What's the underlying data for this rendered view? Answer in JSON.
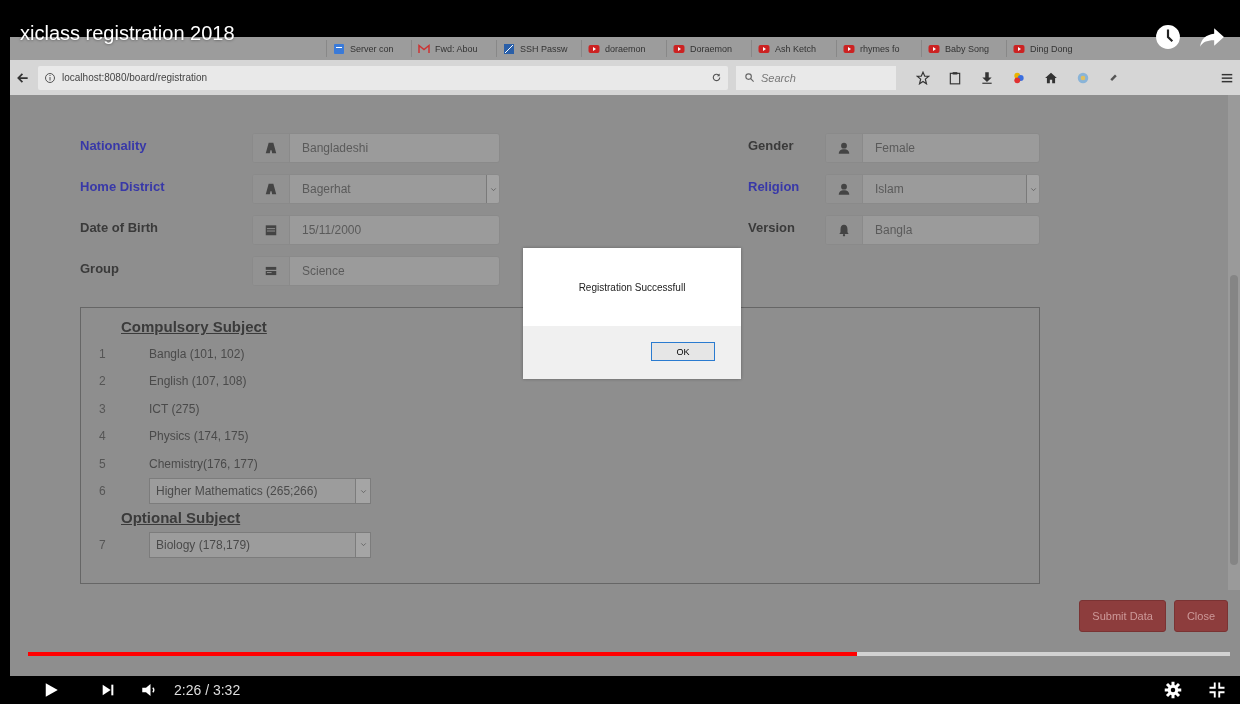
{
  "video": {
    "title": "xiclass registration 2018"
  },
  "browser": {
    "tabs": [
      {
        "label": "Server con",
        "kind": "chat"
      },
      {
        "label": "Fwd: Abou",
        "kind": "mail"
      },
      {
        "label": "SSH Passw",
        "kind": "doc"
      },
      {
        "label": "doraemon",
        "kind": "video"
      },
      {
        "label": "Doraemon",
        "kind": "video"
      },
      {
        "label": "Ash Ketch",
        "kind": "video"
      },
      {
        "label": "rhymes fo",
        "kind": "video"
      },
      {
        "label": "Baby Song",
        "kind": "video"
      },
      {
        "label": "Ding Dong",
        "kind": "video"
      }
    ],
    "url": "localhost:8080/board/registration",
    "search": {
      "placeholder": "Search"
    }
  },
  "form": {
    "left_fields": [
      {
        "label": "Nationality",
        "value": "Bangladeshi",
        "required": true,
        "kind": "text"
      },
      {
        "label": "Home District",
        "value": "Bagerhat",
        "required": true,
        "kind": "select"
      },
      {
        "label": "Date of Birth",
        "value": "15/11/2000",
        "required": false,
        "kind": "text"
      },
      {
        "label": "Group",
        "value": "Science",
        "required": false,
        "kind": "text"
      }
    ],
    "right_fields": [
      {
        "label": "Gender",
        "value": "Female",
        "required": false,
        "kind": "text"
      },
      {
        "label": "Religion",
        "value": "Islam",
        "required": true,
        "kind": "select"
      },
      {
        "label": "Version",
        "value": "Bangla",
        "required": false,
        "kind": "text"
      }
    ]
  },
  "subjects": {
    "compulsory_heading": "Compulsory Subject",
    "compulsory": [
      {
        "number": "1",
        "name": "Bangla (101, 102)",
        "kind": "text"
      },
      {
        "number": "2",
        "name": "English (107, 108)",
        "kind": "text"
      },
      {
        "number": "3",
        "name": "ICT (275)",
        "kind": "text"
      },
      {
        "number": "4",
        "name": "Physics (174, 175)",
        "kind": "text"
      },
      {
        "number": "5",
        "name": "Chemistry(176, 177)",
        "kind": "text"
      },
      {
        "number": "6",
        "name": "Higher Mathematics (265;266)",
        "kind": "select"
      }
    ],
    "optional_heading": "Optional Subject",
    "optional": [
      {
        "number": "7",
        "name": "Biology (178,179)",
        "kind": "select"
      }
    ]
  },
  "buttons": [
    "Submit Data",
    "Close"
  ],
  "dialog": {
    "message": "Registration Successfull",
    "button": "OK"
  },
  "player": {
    "progress": {
      "level": 0.69
    },
    "time": "2:26 / 3:32"
  }
}
